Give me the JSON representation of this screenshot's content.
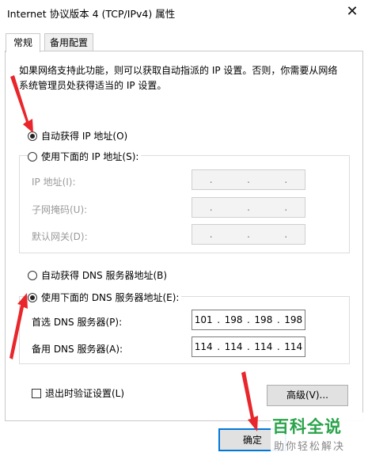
{
  "window": {
    "title": "Internet 协议版本 4 (TCP/IPv4) 属性",
    "close_glyph": "✕"
  },
  "tabs": [
    {
      "label": "常规"
    },
    {
      "label": "备用配置"
    }
  ],
  "description": "如果网络支持此功能，则可以获取自动指派的 IP 设置。否则，你需要从网络系统管理员处获得适当的 IP 设置。",
  "ip": {
    "auto_label": "自动获得 IP 地址(O)",
    "manual_label": "使用下面的 IP 地址(S):",
    "selected": "auto",
    "fields": [
      {
        "label": "IP 地址(I):"
      },
      {
        "label": "子网掩码(U):"
      },
      {
        "label": "默认网关(D):"
      }
    ]
  },
  "dns": {
    "auto_label": "自动获得 DNS 服务器地址(B)",
    "manual_label": "使用下面的 DNS 服务器地址(E):",
    "selected": "manual",
    "preferred": {
      "label": "首选 DNS 服务器(P):",
      "octets": [
        "101",
        "198",
        "198",
        "198"
      ]
    },
    "alternate": {
      "label": "备用 DNS 服务器(A):",
      "octets": [
        "114",
        "114",
        "114",
        "114"
      ]
    }
  },
  "validate_on_exit": {
    "label": "退出时验证设置(L)",
    "checked": false
  },
  "buttons": {
    "advanced": "高级(V)...",
    "ok": "确定"
  },
  "watermark": {
    "title": "百科全说",
    "subtitle": "助你轻松解决"
  },
  "colors": {
    "annotation_arrow": "#e8262b",
    "watermark_green": "#2aa34a"
  }
}
